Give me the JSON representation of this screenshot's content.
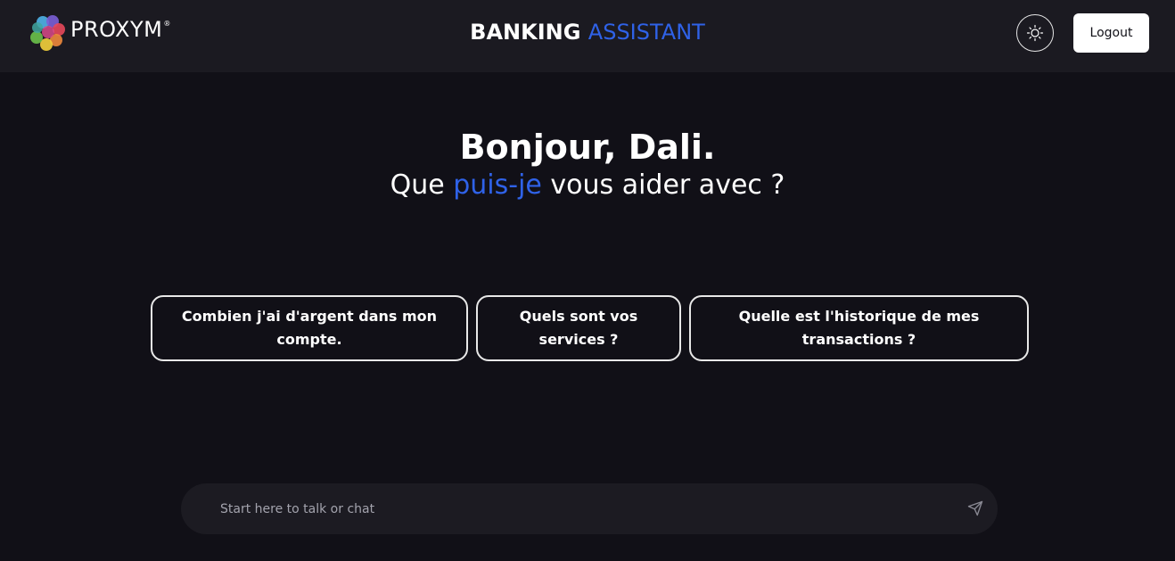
{
  "header": {
    "logo_text": "PROXYM",
    "logo_mark": "®",
    "title_part1": "BANKING",
    "title_part2": "ASSISTANT",
    "theme_toggle_icon": "sun-icon",
    "logout_label": "Logout"
  },
  "hero": {
    "greeting": "Bonjour, Dali.",
    "sub_before": "Que ",
    "sub_accent": "puis-je",
    "sub_after": " vous aider avec ?"
  },
  "suggestions": [
    {
      "label": "Combien j'ai d'argent dans mon compte."
    },
    {
      "label": "Quels sont vos services ?"
    },
    {
      "label": "Quelle est l'historique de mes transactions ?"
    }
  ],
  "chat": {
    "placeholder": "Start here to talk or chat",
    "send_icon": "send-icon"
  },
  "colors": {
    "background": "#111017",
    "header_bg": "#1b1a21",
    "accent": "#2f62e8",
    "input_bg": "#1c1b22"
  }
}
